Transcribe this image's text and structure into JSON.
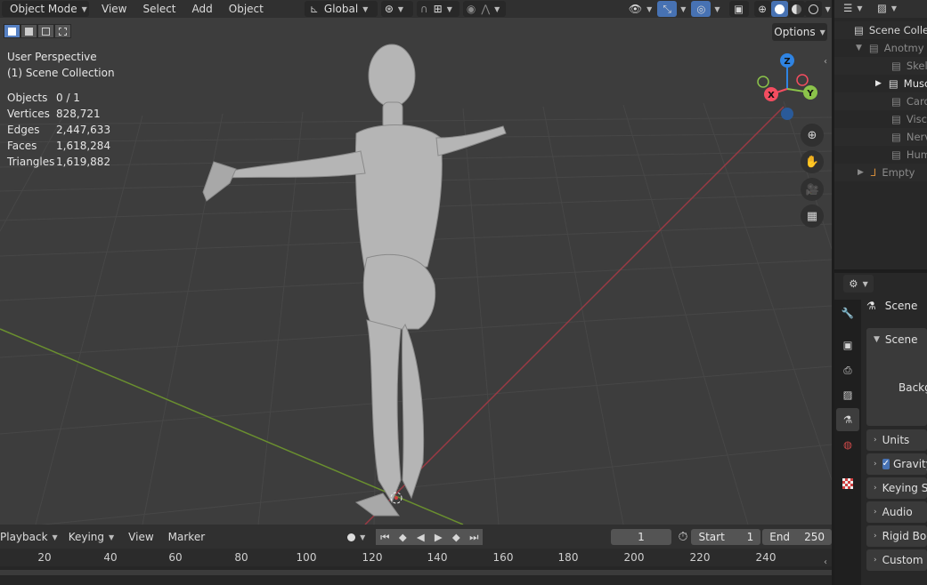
{
  "header": {
    "mode": "Object Mode",
    "menus": [
      "View",
      "Select",
      "Add",
      "Object"
    ],
    "orientation": "Global"
  },
  "viewport": {
    "perspective": "User Perspective",
    "collection": "(1) Scene Collection",
    "stats": [
      {
        "label": "Objects",
        "value": "0 / 1"
      },
      {
        "label": "Vertices",
        "value": "828,721"
      },
      {
        "label": "Edges",
        "value": "2,447,633"
      },
      {
        "label": "Faces",
        "value": "1,618,284"
      },
      {
        "label": "Triangles",
        "value": "1,619,882"
      }
    ],
    "options_label": "Options",
    "gizmo": {
      "x": "X",
      "y": "Y",
      "z": "Z"
    }
  },
  "timeline": {
    "menus": [
      "Playback",
      "Keying",
      "View",
      "Marker"
    ],
    "current_frame": "1",
    "start_label": "Start",
    "start_value": "1",
    "end_label": "End",
    "end_value": "250",
    "ruler": [
      "20",
      "40",
      "60",
      "80",
      "100",
      "120",
      "140",
      "160",
      "180",
      "200",
      "220",
      "240"
    ]
  },
  "outliner": {
    "root": "Scene Collection",
    "items": [
      {
        "label": "Anotmy"
      },
      {
        "label": "Skeleton"
      },
      {
        "label": "Muscles"
      },
      {
        "label": "Cardiovascular"
      },
      {
        "label": "Viscera"
      },
      {
        "label": "Nervous"
      },
      {
        "label": "Human"
      },
      {
        "label": "Empty"
      }
    ]
  },
  "properties": {
    "context": "Scene",
    "panel_scene": "Scene",
    "background_label": "Background",
    "panels": [
      "Units",
      "Gravity",
      "Keying Sets",
      "Audio",
      "Rigid Body World",
      "Custom Properties"
    ]
  },
  "colors": {
    "accent": "#4772b3",
    "axis_x": "#f44d60",
    "axis_y": "#8bc34a",
    "axis_z": "#2f84e3"
  }
}
